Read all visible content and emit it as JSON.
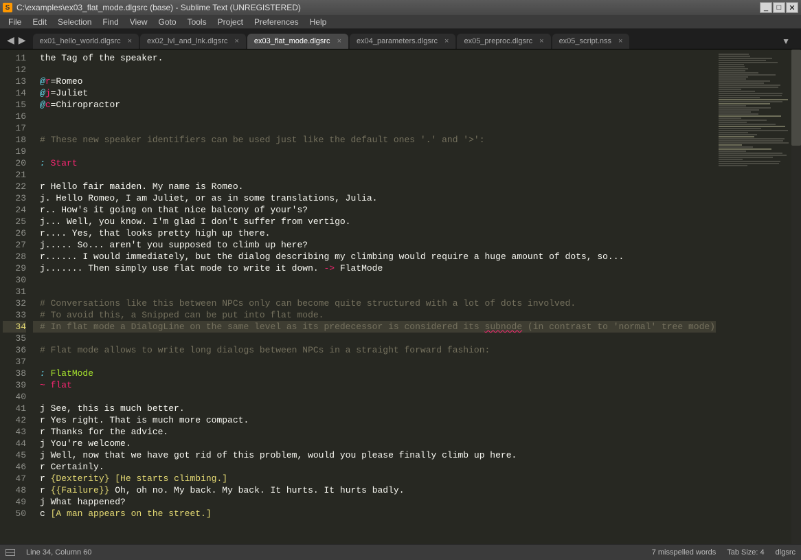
{
  "window": {
    "title": "C:\\examples\\ex03_flat_mode.dlgsrc (base) - Sublime Text (UNREGISTERED)"
  },
  "menu": [
    "File",
    "Edit",
    "Selection",
    "Find",
    "View",
    "Goto",
    "Tools",
    "Project",
    "Preferences",
    "Help"
  ],
  "tabs": [
    {
      "label": "ex01_hello_world.dlgsrc",
      "active": false
    },
    {
      "label": "ex02_lvl_and_lnk.dlgsrc",
      "active": false
    },
    {
      "label": "ex03_flat_mode.dlgsrc",
      "active": true
    },
    {
      "label": "ex04_parameters.dlgsrc",
      "active": false
    },
    {
      "label": "ex05_preproc.dlgsrc",
      "active": false
    },
    {
      "label": "ex05_script.nss",
      "active": false
    }
  ],
  "first_line_number": 11,
  "current_line_index": 23,
  "lines": [
    [
      {
        "c": "c-text",
        "t": "the Tag of the speaker."
      }
    ],
    [
      {
        "c": "c-text",
        "t": ""
      }
    ],
    [
      {
        "c": "c-kw",
        "t": "@"
      },
      {
        "c": "c-key",
        "t": "r"
      },
      {
        "c": "c-text",
        "t": "=Romeo"
      }
    ],
    [
      {
        "c": "c-kw",
        "t": "@"
      },
      {
        "c": "c-key",
        "t": "j"
      },
      {
        "c": "c-text",
        "t": "=Juliet"
      }
    ],
    [
      {
        "c": "c-kw",
        "t": "@"
      },
      {
        "c": "c-key",
        "t": "c"
      },
      {
        "c": "c-text",
        "t": "=Chiropractor"
      }
    ],
    [
      {
        "c": "c-text",
        "t": ""
      }
    ],
    [
      {
        "c": "c-text",
        "t": ""
      }
    ],
    [
      {
        "c": "c-comment",
        "t": "# These new speaker identifiers can be used just like the default ones '.' and '>':"
      }
    ],
    [
      {
        "c": "c-text",
        "t": ""
      }
    ],
    [
      {
        "c": "c-kw",
        "t": ": "
      },
      {
        "c": "c-pink",
        "t": "Start"
      }
    ],
    [
      {
        "c": "c-text",
        "t": ""
      }
    ],
    [
      {
        "c": "c-text",
        "t": "r Hello fair maiden. My name is Romeo."
      }
    ],
    [
      {
        "c": "c-text",
        "t": "j. Hello Romeo, I am Juliet, or as in some translations, Julia."
      }
    ],
    [
      {
        "c": "c-text",
        "t": "r.. How's it going on that nice balcony of your's?"
      }
    ],
    [
      {
        "c": "c-text",
        "t": "j... Well, you know. I'm glad I don't suffer from vertigo."
      }
    ],
    [
      {
        "c": "c-text",
        "t": "r.... Yes, that looks pretty high up there."
      }
    ],
    [
      {
        "c": "c-text",
        "t": "j..... So... aren't you supposed to climb up here?"
      }
    ],
    [
      {
        "c": "c-text",
        "t": "r...... I would immediately, but the dialog describing my climbing would require a huge amount of dots, so..."
      }
    ],
    [
      {
        "c": "c-text",
        "t": "j....... Then simply use flat mode to write it down. "
      },
      {
        "c": "c-arrow",
        "t": "->"
      },
      {
        "c": "c-text",
        "t": " FlatMode"
      }
    ],
    [
      {
        "c": "c-text",
        "t": ""
      }
    ],
    [
      {
        "c": "c-text",
        "t": ""
      }
    ],
    [
      {
        "c": "c-comment",
        "t": "# Conversations like this between NPCs only can become quite structured with a lot of dots involved."
      }
    ],
    [
      {
        "c": "c-comment",
        "t": "# To avoid this, a Snipped can be put into flat mode."
      }
    ],
    [
      {
        "c": "c-comment",
        "t": "# In flat mode a DialogLine on the same level as its predecessor is considered its "
      },
      {
        "c": "c-comment squiggle",
        "t": "subnode"
      },
      {
        "c": "c-comment",
        "t": " (in contrast to 'normal' tree mode)."
      }
    ],
    [
      {
        "c": "c-text",
        "t": ""
      }
    ],
    [
      {
        "c": "c-comment",
        "t": "# Flat mode allows to write long dialogs between NPCs in a straight forward fashion:"
      }
    ],
    [
      {
        "c": "c-text",
        "t": ""
      }
    ],
    [
      {
        "c": "c-kw",
        "t": ": "
      },
      {
        "c": "c-label",
        "t": "FlatMode"
      }
    ],
    [
      {
        "c": "c-tilde",
        "t": "~ "
      },
      {
        "c": "c-pink",
        "t": "flat"
      }
    ],
    [
      {
        "c": "c-text",
        "t": ""
      }
    ],
    [
      {
        "c": "c-text",
        "t": "j See, this is much better."
      }
    ],
    [
      {
        "c": "c-text",
        "t": "r Yes right. That is much more compact."
      }
    ],
    [
      {
        "c": "c-text",
        "t": "r Thanks for the advice."
      }
    ],
    [
      {
        "c": "c-text",
        "t": "j You're welcome."
      }
    ],
    [
      {
        "c": "c-text",
        "t": "j Well, now that we have got rid of this problem, would you please finally climb up here."
      }
    ],
    [
      {
        "c": "c-text",
        "t": "r Certainly."
      }
    ],
    [
      {
        "c": "c-text",
        "t": "r "
      },
      {
        "c": "c-curly",
        "t": "{Dexterity}"
      },
      {
        "c": "c-text",
        "t": " "
      },
      {
        "c": "c-bracket",
        "t": "[He starts climbing.]"
      }
    ],
    [
      {
        "c": "c-text",
        "t": "r "
      },
      {
        "c": "c-curly",
        "t": "{{Failure}}"
      },
      {
        "c": "c-text",
        "t": " Oh, oh no. My back. My back. It hurts. It hurts badly."
      }
    ],
    [
      {
        "c": "c-text",
        "t": "j What happened?"
      }
    ],
    [
      {
        "c": "c-text",
        "t": "c "
      },
      {
        "c": "c-bracket",
        "t": "[A man appears on the street.]"
      }
    ]
  ],
  "status": {
    "position": "Line 34, Column 60",
    "spell": "7 misspelled words",
    "tabsize": "Tab Size: 4",
    "syntax": "dlgsrc"
  }
}
